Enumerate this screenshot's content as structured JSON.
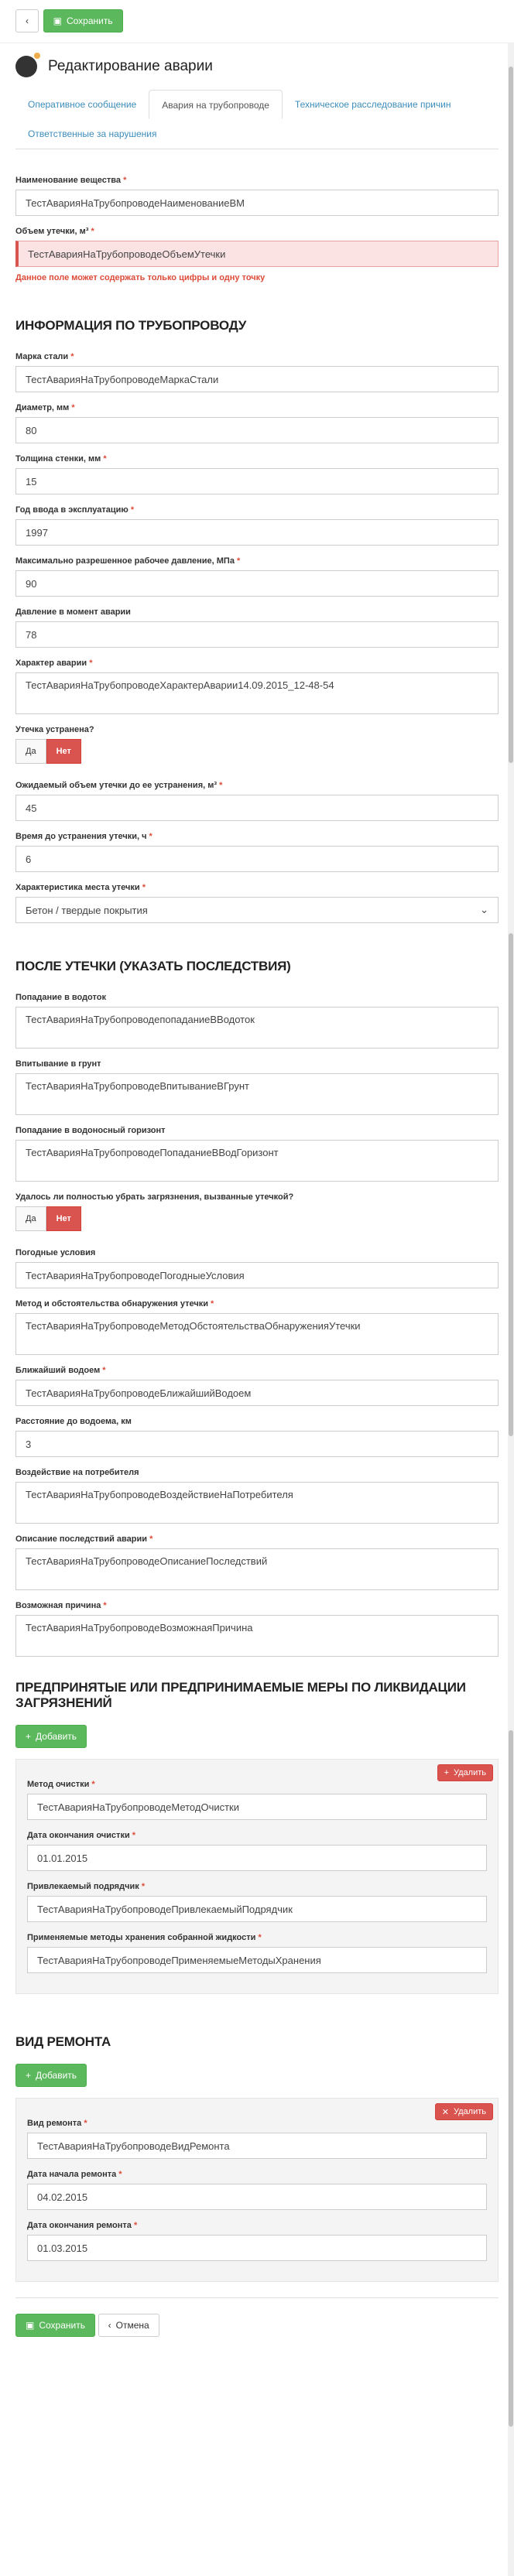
{
  "toolbar": {
    "save_label": "Сохранить"
  },
  "header": {
    "title": "Редактирование аварии"
  },
  "tabs": [
    {
      "label": "Оперативное сообщение"
    },
    {
      "label": "Авария на трубопроводе"
    },
    {
      "label": "Техническое расследование причин"
    },
    {
      "label": "Ответственные за нарушения"
    }
  ],
  "top": {
    "substance_label": "Наименование вещества",
    "substance_value": "ТестАварияНаТрубопроводеНаименованиеВМ",
    "volume_label": "Объем утечки, м³",
    "volume_value": "ТестАварияНаТрубопроводеОбъемУтечки",
    "volume_error": "Данное поле может содержать только цифры и одну точку"
  },
  "pipe": {
    "title": "ИНФОРМАЦИЯ ПО ТРУБОПРОВОДУ",
    "steel_label": "Марка стали",
    "steel_value": "ТестАварияНаТрубопроводеМаркаСтали",
    "diameter_label": "Диаметр, мм",
    "diameter_value": "80",
    "thickness_label": "Толщина стенки, мм",
    "thickness_value": "15",
    "year_label": "Год ввода в эксплуатацию",
    "year_value": "1997",
    "pressure_max_label": "Максимально разрешенное рабочее давление, МПа",
    "pressure_max_value": "90",
    "pressure_label": "Давление в момент аварии",
    "pressure_value": "78",
    "nature_label": "Характер аварии",
    "nature_value": "ТестАварияНаТрубопроводеХарактерАварии14.09.2015_12-48-54",
    "fixed_label": "Утечка устранена?",
    "yes": "Да",
    "no": "Нет",
    "expected_label": "Ожидаемый объем утечки до ее устранения, м³",
    "expected_value": "45",
    "time_label": "Время до устранения утечки, ч",
    "time_value": "6",
    "place_label": "Характеристика места утечки",
    "place_value": "Бетон / твердые покрытия"
  },
  "after": {
    "title": "ПОСЛЕ УТЕЧКИ (УКАЗАТЬ ПОСЛЕДСТВИЯ)",
    "water_label": "Попадание в водоток",
    "water_value": "ТестАварияНаТрубопроводепопаданиеВВодоток",
    "soil_label": "Впитывание в грунт",
    "soil_value": "ТестАварияНаТрубопроводеВпитываниеВГрунт",
    "horizon_label": "Попадание в водоносный горизонт",
    "horizon_value": "ТестАварияНаТрубопроводеПопаданиеВВодГоризонт",
    "clean_label": "Удалось ли полностью убрать загрязнения, вызванные утечкой?",
    "yes": "Да",
    "no": "Нет",
    "weather_label": "Погодные условия",
    "weather_value": "ТестАварияНаТрубопроводеПогодныеУсловия",
    "method_label": "Метод и обстоятельства обнаружения утечки",
    "method_value": "ТестАварияНаТрубопроводеМетодОбстоятельстваОбнаруженияУтечки",
    "pond_label": "Ближайший водоем",
    "pond_value": "ТестАварияНаТрубопроводеБлижайшийВодоем",
    "distance_label": "Расстояние до водоема, км",
    "distance_value": "3",
    "impact_label": "Воздействие на потребителя",
    "impact_value": "ТестАварияНаТрубопроводеВоздействиеНаПотребителя",
    "consequences_label": "Описание последствий аварии",
    "consequences_value": "ТестАварияНаТрубопроводеОписаниеПоследствий",
    "cause_label": "Возможная причина",
    "cause_value": "ТестАварияНаТрубопроводеВозможнаяПричина"
  },
  "measures": {
    "title": "ПРЕДПРИНЯТЫЕ ИЛИ ПРЕДПРИНИМАЕМЫЕ МЕРЫ ПО ЛИКВИДАЦИИ ЗАГРЯЗНЕНИЙ",
    "add_label": "Добавить",
    "delete_label": "Удалить",
    "clean_method_label": "Метод очистки",
    "clean_method_value": "ТестАварияНаТрубопроводеМетодОчистки",
    "end_label": "Дата окончания очистки",
    "end_value": "01.01.2015",
    "contractor_label": "Привлекаемый подрядчик",
    "contractor_value": "ТестАварияНаТрубопроводеПривлекаемыйПодрядчик",
    "storage_label": "Применяемые методы хранения собранной жидкости",
    "storage_value": "ТестАварияНаТрубопроводеПрименяемыеМетодыХранения"
  },
  "repair": {
    "title": "ВИД РЕМОНТА",
    "add_label": "Добавить",
    "delete_label": "Удалить",
    "type_label": "Вид ремонта",
    "type_value": "ТестАварияНаТрубопроводеВидРемонта",
    "start_label": "Дата начала ремонта",
    "start_value": "04.02.2015",
    "end_label": "Дата окончания ремонта",
    "end_value": "01.03.2015"
  },
  "footer": {
    "save_label": "Сохранить",
    "cancel_label": "Отмена"
  },
  "colors": {
    "primary": "#3c8dbc",
    "success": "#5cb85c",
    "danger": "#d9534f",
    "error_bg": "#fbe3e4"
  }
}
